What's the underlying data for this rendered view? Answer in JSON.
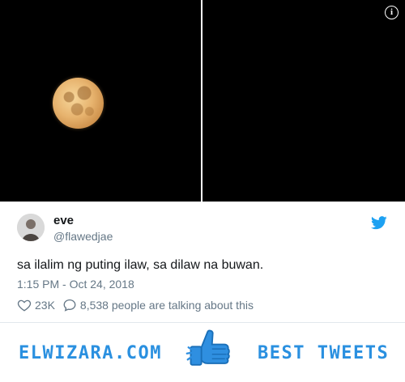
{
  "media": {
    "info_icon": "info-icon",
    "photos": [
      "moon-photo",
      "moon-photo"
    ]
  },
  "tweet": {
    "display_name": "eve",
    "handle": "@flawedjae",
    "text": "sa ilalim ng puting ilaw, sa dilaw na buwan.",
    "timestamp": "1:15 PM - Oct 24, 2018",
    "likes": "23K",
    "talking": "8,538 people are talking about this",
    "brand_icon": "twitter-bird-icon"
  },
  "footer": {
    "brand": "ELWIZARA.COM",
    "tagline": "BEST TWEETS",
    "icon": "thumbs-up-icon"
  },
  "colors": {
    "twitter_blue": "#1da1f2",
    "footer_blue": "#2a90e0",
    "muted_text": "#657786"
  }
}
